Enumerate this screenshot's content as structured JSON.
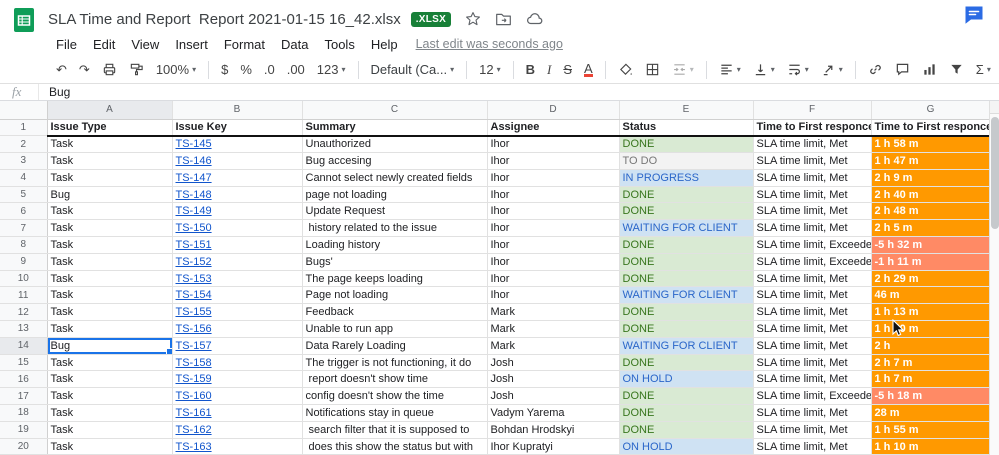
{
  "colors": {
    "accent_blue": "#1a73e8",
    "link": "#1155cc",
    "time_met": "#ff9900",
    "time_exceeded": "#ff8a65",
    "badge_green": "#188038",
    "logo_green": "#0f9d58"
  },
  "titlebar": {
    "title": "SLA Time and Report  Report 2021-01-15 16_42.xlsx",
    "badge": ".XLSX"
  },
  "menubar": {
    "items": [
      "File",
      "Edit",
      "View",
      "Insert",
      "Format",
      "Data",
      "Tools",
      "Help"
    ],
    "last_edit": "Last edit was seconds ago"
  },
  "toolbar": {
    "zoom": "100%",
    "currency": "$",
    "percent": "%",
    "decrease_decimal": ".0",
    "increase_decimal": ".00",
    "more_formats": "123",
    "font_name": "Default (Ca...",
    "font_size": "12",
    "bold": "B",
    "italic": "I",
    "strikethrough": "S",
    "text_color": "A",
    "functions": "Σ"
  },
  "formula_bar": {
    "label": "fx",
    "value": "Bug"
  },
  "sheet": {
    "column_letters": [
      "A",
      "B",
      "C",
      "D",
      "E",
      "F",
      "G"
    ],
    "header_row_number": "1",
    "header_row": [
      "Issue Type",
      "Issue Key",
      "Summary",
      "Assignee",
      "Status",
      "Time to First responce",
      "Time to First responce"
    ],
    "selected": {
      "row": 14,
      "col": "A"
    },
    "status_styles": {
      "DONE": {
        "bg": "#d9ead3",
        "fg": "#38761d"
      },
      "TO DO": {
        "bg": "#f3f3f3",
        "fg": "#777777"
      },
      "IN PROGRESS": {
        "bg": "#cfe2f3",
        "fg": "#2a66c9"
      },
      "WAITING FOR CLIENT": {
        "bg": "#cfe2f3",
        "fg": "#2a66c9"
      },
      "ON HOLD": {
        "bg": "#cfe2f3",
        "fg": "#2a66c9"
      }
    },
    "rows": [
      {
        "n": 2,
        "type": "Task",
        "key": "TS-145",
        "summary": "Unauthorized",
        "assignee": "Ihor",
        "status": "DONE",
        "sla": "SLA time limit, Met",
        "time": "1 h 58 m",
        "exceeded": false
      },
      {
        "n": 3,
        "type": "Task",
        "key": "TS-146",
        "summary": "Bug accesing",
        "assignee": "Ihor",
        "status": "TO DO",
        "sla": "SLA time limit, Met",
        "time": "1 h 47 m",
        "exceeded": false
      },
      {
        "n": 4,
        "type": "Task",
        "key": "TS-147",
        "summary": "Cannot select newly created fields",
        "assignee": "Ihor",
        "status": "IN PROGRESS",
        "sla": "SLA time limit, Met",
        "time": "2 h 9 m",
        "exceeded": false
      },
      {
        "n": 5,
        "type": "Bug",
        "key": "TS-148",
        "summary": "page not loading",
        "assignee": "Ihor",
        "status": "DONE",
        "sla": "SLA time limit, Met",
        "time": "2 h 40 m",
        "exceeded": false
      },
      {
        "n": 6,
        "type": "Task",
        "key": "TS-149",
        "summary": "Update Request",
        "assignee": "Ihor",
        "status": "DONE",
        "sla": "SLA time limit, Met",
        "time": "2 h 48 m",
        "exceeded": false
      },
      {
        "n": 7,
        "type": "Task",
        "key": "TS-150",
        "summary": " history related to the issue",
        "assignee": "Ihor",
        "status": "WAITING FOR CLIENT",
        "sla": "SLA time limit, Met",
        "time": "2 h 5 m",
        "exceeded": false
      },
      {
        "n": 8,
        "type": "Task",
        "key": "TS-151",
        "summary": "Loading history",
        "assignee": "Ihor",
        "status": "DONE",
        "sla": "SLA time limit, Exceeded",
        "time": "-5 h 32 m",
        "exceeded": true
      },
      {
        "n": 9,
        "type": "Task",
        "key": "TS-152",
        "summary": "Bugs'",
        "assignee": "Ihor",
        "status": "DONE",
        "sla": "SLA time limit, Exceeded",
        "time": "-1 h 11 m",
        "exceeded": true
      },
      {
        "n": 10,
        "type": "Task",
        "key": "TS-153",
        "summary": "The page keeps loading",
        "assignee": "Ihor",
        "status": "DONE",
        "sla": "SLA time limit, Met",
        "time": "2 h 29 m",
        "exceeded": false
      },
      {
        "n": 11,
        "type": "Task",
        "key": "TS-154",
        "summary": "Page not loading",
        "assignee": "Ihor",
        "status": "WAITING FOR CLIENT",
        "sla": "SLA time limit, Met",
        "time": "46 m",
        "exceeded": false
      },
      {
        "n": 12,
        "type": "Task",
        "key": "TS-155",
        "summary": "Feedback",
        "assignee": "Mark",
        "status": "DONE",
        "sla": "SLA time limit, Met",
        "time": "1 h 13 m",
        "exceeded": false
      },
      {
        "n": 13,
        "type": "Task",
        "key": "TS-156",
        "summary": "Unable to run app",
        "assignee": "Mark",
        "status": "DONE",
        "sla": "SLA time limit, Met",
        "time": "1 h 50 m",
        "exceeded": false
      },
      {
        "n": 14,
        "type": "Bug",
        "key": "TS-157",
        "summary": "Data Rarely Loading",
        "assignee": "Mark",
        "status": "WAITING FOR CLIENT",
        "sla": "SLA time limit, Met",
        "time": "2 h",
        "exceeded": false
      },
      {
        "n": 15,
        "type": "Task",
        "key": "TS-158",
        "summary": "The trigger is not functioning, it do",
        "assignee": "Josh",
        "status": "DONE",
        "sla": "SLA time limit, Met",
        "time": "2 h 7 m",
        "exceeded": false
      },
      {
        "n": 16,
        "type": "Task",
        "key": "TS-159",
        "summary": " report doesn't show time",
        "assignee": "Josh",
        "status": "ON HOLD",
        "sla": "SLA time limit, Met",
        "time": "1 h 7 m",
        "exceeded": false
      },
      {
        "n": 17,
        "type": "Task",
        "key": "TS-160",
        "summary": "config doesn't show the time",
        "assignee": "Josh",
        "status": "DONE",
        "sla": "SLA time limit, Exceeded",
        "time": "-5 h 18 m",
        "exceeded": true
      },
      {
        "n": 18,
        "type": "Task",
        "key": "TS-161",
        "summary": "Notifications stay in queue",
        "assignee": "Vadym Yarema",
        "status": "DONE",
        "sla": "SLA time limit, Met",
        "time": "28 m",
        "exceeded": false
      },
      {
        "n": 19,
        "type": "Task",
        "key": "TS-162",
        "summary": " search filter that it is supposed to",
        "assignee": "Bohdan Hrodskyi",
        "status": "DONE",
        "sla": "SLA time limit, Met",
        "time": "1 h 55 m",
        "exceeded": false
      },
      {
        "n": 20,
        "type": "Task",
        "key": "TS-163",
        "summary": " does this show the status but with",
        "assignee": "Ihor Kupratyi",
        "status": "ON HOLD",
        "sla": "SLA time limit, Met",
        "time": "1 h 10 m",
        "exceeded": false
      }
    ]
  }
}
